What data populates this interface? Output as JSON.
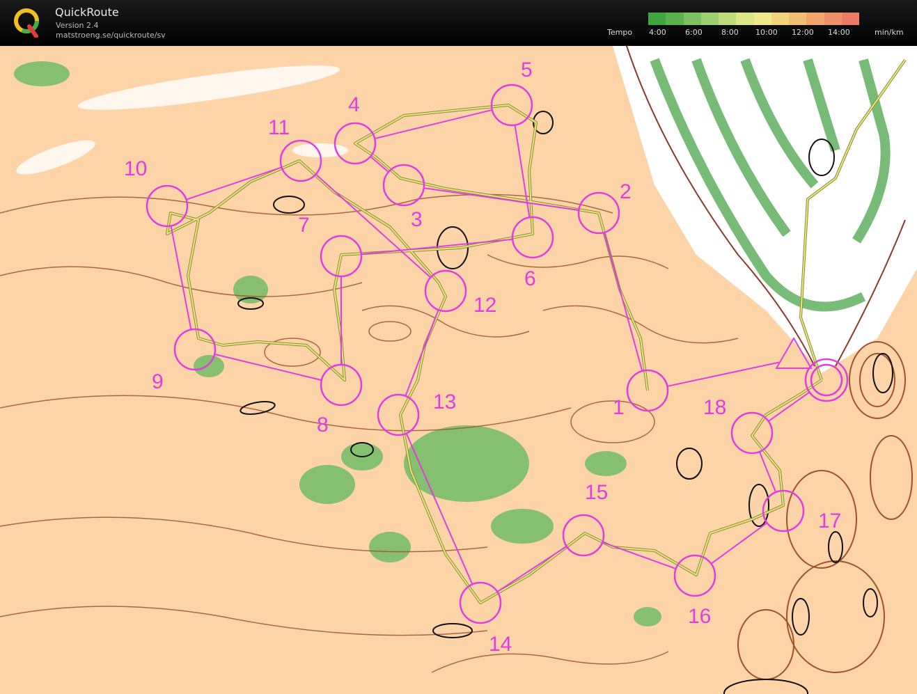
{
  "app": {
    "title": "QuickRoute",
    "version": "Version 2.4",
    "url": "matstroeng.se/quickroute/sv"
  },
  "legend": {
    "label": "Tempo",
    "unit": "min/km",
    "ticks": [
      "4:00",
      "6:00",
      "8:00",
      "10:00",
      "12:00",
      "14:00"
    ],
    "colors": [
      "#3fa63f",
      "#5bb24b",
      "#7cc060",
      "#9ccf6f",
      "#bddc7c",
      "#dde58a",
      "#f0e88c",
      "#f3d47e",
      "#f2bd74",
      "#f0a56c",
      "#ee9068",
      "#ec7c66"
    ]
  },
  "map": {
    "background": "#fdd4a8",
    "course_color": "#e23ce0",
    "route_color": "#c8c860",
    "controls": [
      {
        "label": "1"
      },
      {
        "label": "2"
      },
      {
        "label": "3"
      },
      {
        "label": "4"
      },
      {
        "label": "5"
      },
      {
        "label": "6"
      },
      {
        "label": "7"
      },
      {
        "label": "8"
      },
      {
        "label": "9"
      },
      {
        "label": "10"
      },
      {
        "label": "11"
      },
      {
        "label": "12"
      },
      {
        "label": "13"
      },
      {
        "label": "14"
      },
      {
        "label": "15"
      },
      {
        "label": "16"
      },
      {
        "label": "17"
      },
      {
        "label": "18"
      }
    ]
  }
}
